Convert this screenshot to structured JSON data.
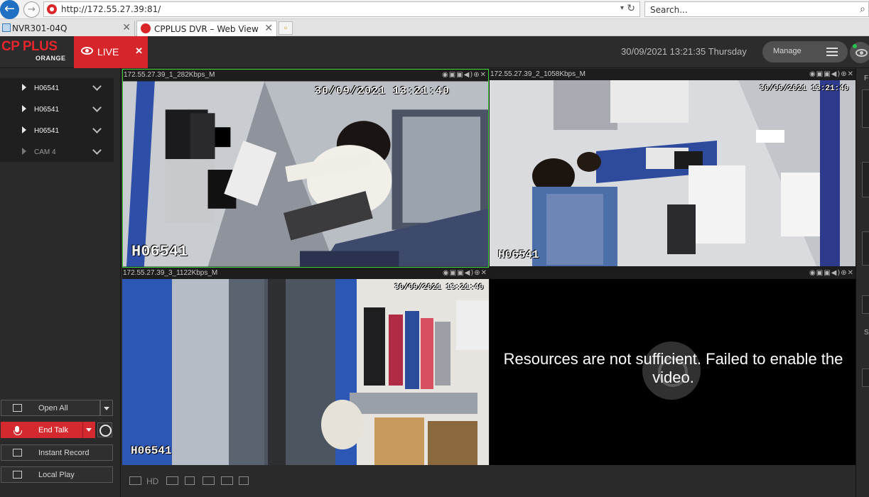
{
  "browser": {
    "url": "http://172.55.27.39:81/",
    "search_placeholder": "Search...",
    "tabs": [
      {
        "label": "NVR301-04Q"
      },
      {
        "label": "CPPLUS DVR – Web View"
      }
    ]
  },
  "header": {
    "logo_main": "CP PLUS",
    "logo_sub": "ORANGE",
    "live_tab": "LIVE",
    "live_close": "✕",
    "datetime": "30/09/2021 13:21:35 Thursday",
    "manage_label": "Manage"
  },
  "sidebar": {
    "channels": [
      {
        "label": "H06541"
      },
      {
        "label": "H06541"
      },
      {
        "label": "H06541"
      },
      {
        "label": "CAM 4"
      }
    ],
    "buttons": {
      "open_all": "Open All",
      "end_talk": "End Talk",
      "instant_record": "Instant Record",
      "local_play": "Local Play"
    }
  },
  "tiles": [
    {
      "title": "172.55.27.39_1_282Kbps_M",
      "osd_time": "30/09/2021 13:21:40",
      "osd_name": "H06541"
    },
    {
      "title": "172.55.27.39_2_1058Kbps_M",
      "osd_time": "30/09/2021 13:21:40",
      "osd_name": "H06541"
    },
    {
      "title": "172.55.27.39_3_1122Kbps_M",
      "osd_time": "30/09/2021 13:21:40",
      "osd_name": "H06541"
    },
    {
      "title": "",
      "error": "Resources are not sufficient. Failed to enable the video."
    }
  ],
  "bottom_bar": {
    "hd_label": "HD"
  },
  "right_strip": {
    "labels": [
      "F",
      "S"
    ]
  }
}
